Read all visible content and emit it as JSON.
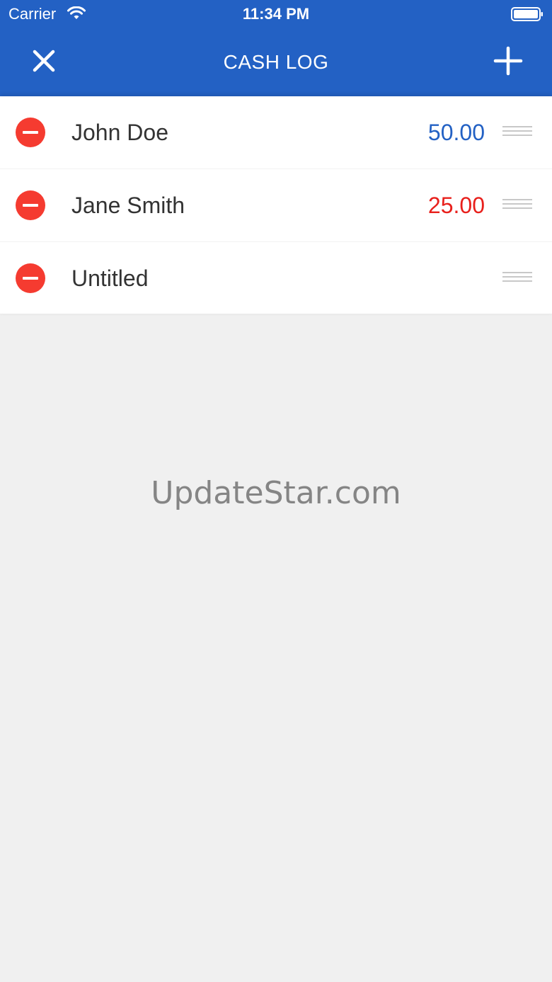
{
  "status_bar": {
    "carrier": "Carrier",
    "time": "11:34 PM",
    "icons": [
      "wifi-icon",
      "battery-icon"
    ]
  },
  "nav": {
    "title": "CASH LOG",
    "left_icon": "close-icon",
    "right_icon": "plus-icon"
  },
  "colors": {
    "header": "#2361c4",
    "positive_amount": "#2361c4",
    "negative_amount": "#e8201c",
    "delete": "#f53b30",
    "background": "#f0f0f0"
  },
  "entries": [
    {
      "name": "John Doe",
      "amount": "50.00",
      "amount_color": "#2361c4"
    },
    {
      "name": "Jane Smith",
      "amount": "25.00",
      "amount_color": "#e8201c"
    },
    {
      "name": "Untitled",
      "amount": "",
      "amount_color": "#333333"
    }
  ],
  "watermark": "UpdateStar.com"
}
